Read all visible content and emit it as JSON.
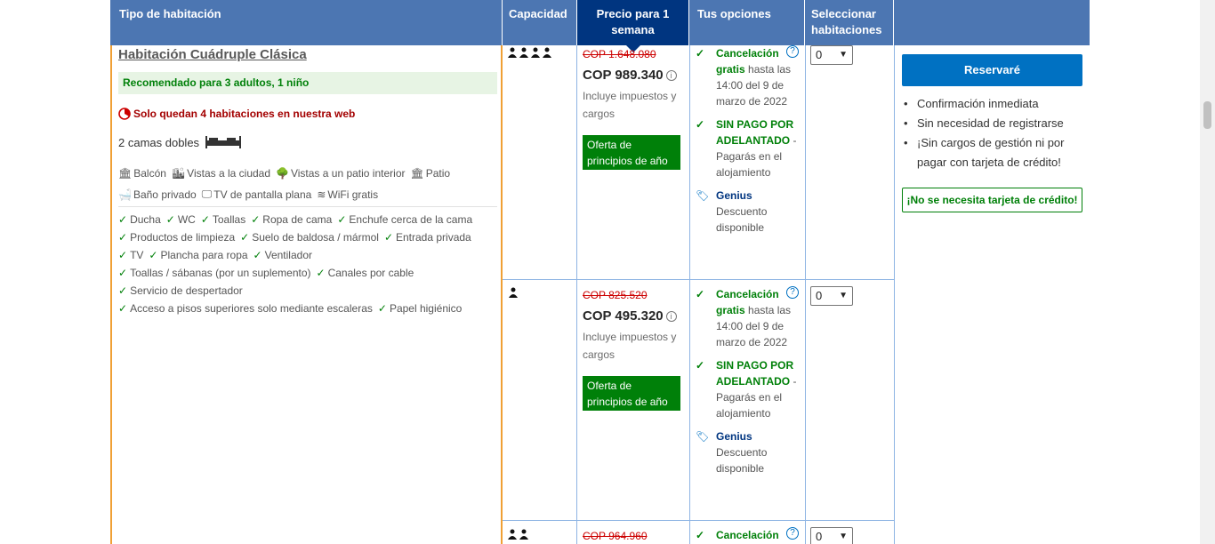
{
  "header": {
    "room_type": "Tipo de habitación",
    "capacity": "Capacidad",
    "price": "Precio para 1 semana",
    "options": "Tus opciones",
    "select": "Seleccionar habitaciones"
  },
  "room": {
    "title": "Habitación Cuádruple Clásica",
    "recommended": "Recomendado para 3 adultos, 1 niño",
    "scarcity": "Solo quedan 4 habitaciones en nuestra web",
    "beds": "2 camas dobles",
    "amenities_row1": [
      "Balcón",
      "Vistas a la ciudad",
      "Vistas a un patio interior",
      "Patio"
    ],
    "amenities_row2": [
      "Baño privado",
      "TV de pantalla plana",
      "WiFi gratis"
    ],
    "features": [
      [
        "Ducha",
        "WC",
        "Toallas",
        "Ropa de cama",
        "Enchufe cerca de la cama"
      ],
      [
        "Productos de limpieza",
        "Suelo de baldosa / mármol",
        "Entrada privada"
      ],
      [
        "TV",
        "Plancha para ropa",
        "Ventilador"
      ],
      [
        "Toallas / sábanas (por un suplemento)",
        "Canales por cable"
      ],
      [
        "Servicio de despertador"
      ],
      [
        "Acceso a pisos superiores solo mediante escaleras",
        "Papel higiénico"
      ]
    ]
  },
  "rows": [
    {
      "capacity_icon": "four-persons-icon",
      "old_price": "COP 1.648.080",
      "price": "COP 989.340",
      "taxes": "Incluye impuestos y cargos",
      "deal": "Oferta de principios de año",
      "cancel_bold": "Cancelación gratis",
      "cancel_rest": " hasta las 14:00 del 9 de marzo de 2022",
      "nopay_bold": "SIN PAGO POR ADELANTADO",
      "nopay_rest": " - Pagarás en el alojamiento",
      "genius": "Genius",
      "genius_text": "Descuento disponible",
      "qty": "0"
    },
    {
      "capacity_icon": "one-person-icon",
      "old_price": "COP 825.520",
      "price": "COP 495.320",
      "taxes": "Incluye impuestos y cargos",
      "deal": "Oferta de principios de año",
      "cancel_bold": "Cancelación gratis",
      "cancel_rest": " hasta las 14:00 del 9 de marzo de 2022",
      "nopay_bold": "SIN PAGO POR ADELANTADO",
      "nopay_rest": " - Pagarás en el alojamiento",
      "genius": "Genius",
      "genius_text": "Descuento disponible",
      "qty": "0"
    },
    {
      "capacity_icon": "two-persons-icon",
      "old_price": "COP 964.960",
      "cancel_bold": "Cancelación",
      "qty": "0"
    }
  ],
  "reserve": {
    "button": "Reservaré",
    "bullets": [
      "Confirmación inmediata",
      "Sin necesidad de registrarse",
      "¡Sin cargos de gestión ni por pagar con tarjeta de crédito!"
    ],
    "no_card": "¡No se necesita tarjeta de crédito!"
  },
  "colors": {
    "header_bg": "#4c76b2",
    "header_selected": "#003580",
    "green": "#008009",
    "red": "#cc0000",
    "blue_button": "#0071c2",
    "orange_border": "#f0a035"
  }
}
